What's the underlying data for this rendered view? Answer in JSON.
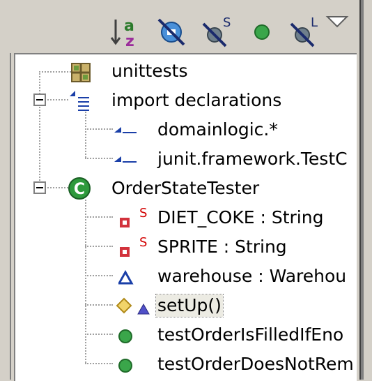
{
  "toolbar": {
    "buttons": [
      {
        "id": "sort",
        "icon": "sort-alpha-icon"
      },
      {
        "id": "hide-fields",
        "icon": "hide-fields-icon"
      },
      {
        "id": "hide-static",
        "icon": "hide-static-icon",
        "badge": "S"
      },
      {
        "id": "hide-nonpublic",
        "icon": "green-dot-icon"
      },
      {
        "id": "hide-local-types",
        "icon": "hide-local-types-icon",
        "badge": "L"
      },
      {
        "id": "view-menu",
        "icon": "triangle-down-icon"
      }
    ]
  },
  "tree": {
    "nodes": [
      {
        "label": "unittests",
        "icon": "package-icon",
        "level": 0
      },
      {
        "label": "import declarations",
        "icon": "imports-icon",
        "level": 0,
        "expanded": true
      },
      {
        "label": "domainlogic.*",
        "icon": "import-icon",
        "level": 1
      },
      {
        "label": "junit.framework.TestC",
        "icon": "import-icon",
        "level": 1
      },
      {
        "label": "OrderStateTester",
        "icon": "class-icon",
        "level": 0,
        "expanded": true
      },
      {
        "label": "DIET_COKE : String",
        "icon": "private-static-field-icon",
        "badge": "S",
        "level": 1
      },
      {
        "label": "SPRITE : String",
        "icon": "private-static-field-icon",
        "badge": "S",
        "level": 1
      },
      {
        "label": "warehouse : Warehou",
        "icon": "default-field-icon",
        "level": 1
      },
      {
        "label": "setUp()",
        "icon": "protected-method-icon",
        "level": 1,
        "selected": true
      },
      {
        "label": "testOrderIsFilledIfEno",
        "icon": "public-method-icon",
        "level": 1
      },
      {
        "label": "testOrderDoesNotRem",
        "icon": "public-method-icon",
        "level": 1
      }
    ]
  },
  "colors": {
    "chrome": "#d4d0c8",
    "tree_bg": "#ffffff",
    "selection": "#ecebe3",
    "method_green": "#2e9a3c",
    "field_red": "#d2323c",
    "badge_red": "#d20000",
    "import_blue": "#1a3fa8"
  }
}
